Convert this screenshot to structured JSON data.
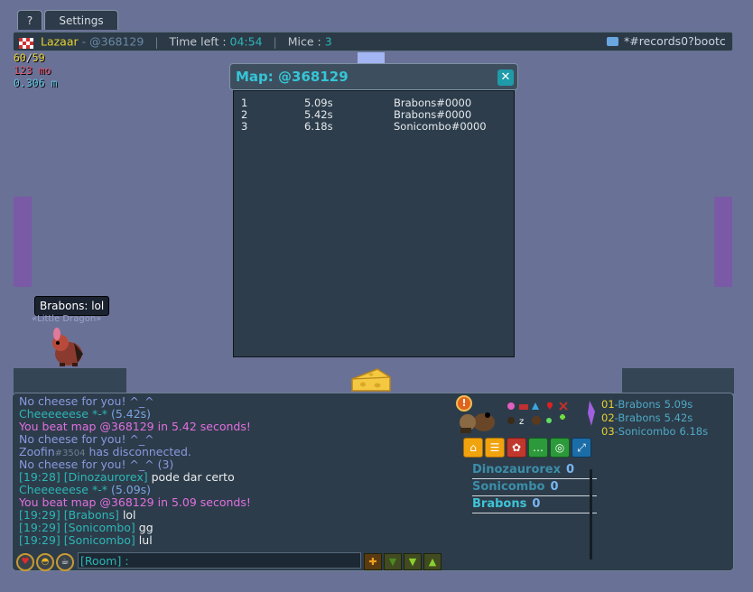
{
  "top_tabs": {
    "help": "?",
    "settings": "Settings"
  },
  "header": {
    "player": "Lazaar",
    "player_tag": " - @368129",
    "time_left_label": "Time left : ",
    "time_left": "04:54",
    "mice_label": "Mice : ",
    "mice": "3",
    "room_link": "*#records0?bootc",
    "separator": "|"
  },
  "stats": {
    "fps_cur": "60",
    "fps_max": "59",
    "sep": "/",
    "memory": "123 mo",
    "time": "0.306 m"
  },
  "speech": {
    "bubble": "Brabons: lol",
    "title": "«Little Dragon»"
  },
  "map_popup": {
    "title": "Map: @368129",
    "rows": [
      {
        "rank": "1",
        "time": "5.09s",
        "player": "Brabons#0000"
      },
      {
        "rank": "2",
        "time": "5.42s",
        "player": "Brabons#0000"
      },
      {
        "rank": "3",
        "time": "6.18s",
        "player": "Sonicombo#0000"
      }
    ]
  },
  "chat": {
    "lines": [
      {
        "text": "No cheese for you! ^_^",
        "color": "#8899e0"
      },
      {
        "text": "Cheeeeeese *-* ",
        "extra": "(5.42s)",
        "color": "#2db6b6"
      },
      {
        "text": "You beat map @368129 in 5.42 seconds!",
        "color": "#e070e0"
      },
      {
        "text": "No cheese for you! ^_^",
        "color": "#8899e0"
      },
      {
        "text": "Zoofin",
        "tag": "#3504",
        "extra": " has disconnected.",
        "color": "#8899e0"
      },
      {
        "text": "No cheese for you! ^_^ (3)",
        "color": "#8899e0"
      },
      {
        "time": "[19:28]",
        "name": "[Dinozaurorex]",
        "msg": "pode dar certo"
      },
      {
        "text": "Cheeeeeese *-* ",
        "extra": "(5.09s)",
        "color": "#2db6b6"
      },
      {
        "text": "You beat map @368129 in 5.09 seconds!",
        "color": "#e070e0"
      },
      {
        "time": "[19:29]",
        "name": "[Brabons]",
        "msg": "lol"
      },
      {
        "time": "[19:29]",
        "name": "[Sonicombo]",
        "msg": "gg"
      },
      {
        "time": "[19:29]",
        "name": "[Sonicombo]",
        "msg": "lul"
      }
    ],
    "input_placeholder": "[Room] :"
  },
  "players": [
    {
      "name": "Dinozaurorex",
      "score": "0"
    },
    {
      "name": "Sonicombo",
      "score": "0"
    },
    {
      "name": "Brabons",
      "score": "0"
    }
  ],
  "ranking": [
    {
      "pos": "01",
      "name": "Brabons",
      "time": "5.09s"
    },
    {
      "pos": "02",
      "name": "Brabons",
      "time": "5.42s"
    },
    {
      "pos": "03",
      "name": "Sonicombo",
      "time": "6.18s"
    }
  ],
  "colors": {
    "bg": "#6a7196",
    "panel": "#2d3c4a",
    "teal": "#2db6b6",
    "yellow": "#e6d22e"
  }
}
